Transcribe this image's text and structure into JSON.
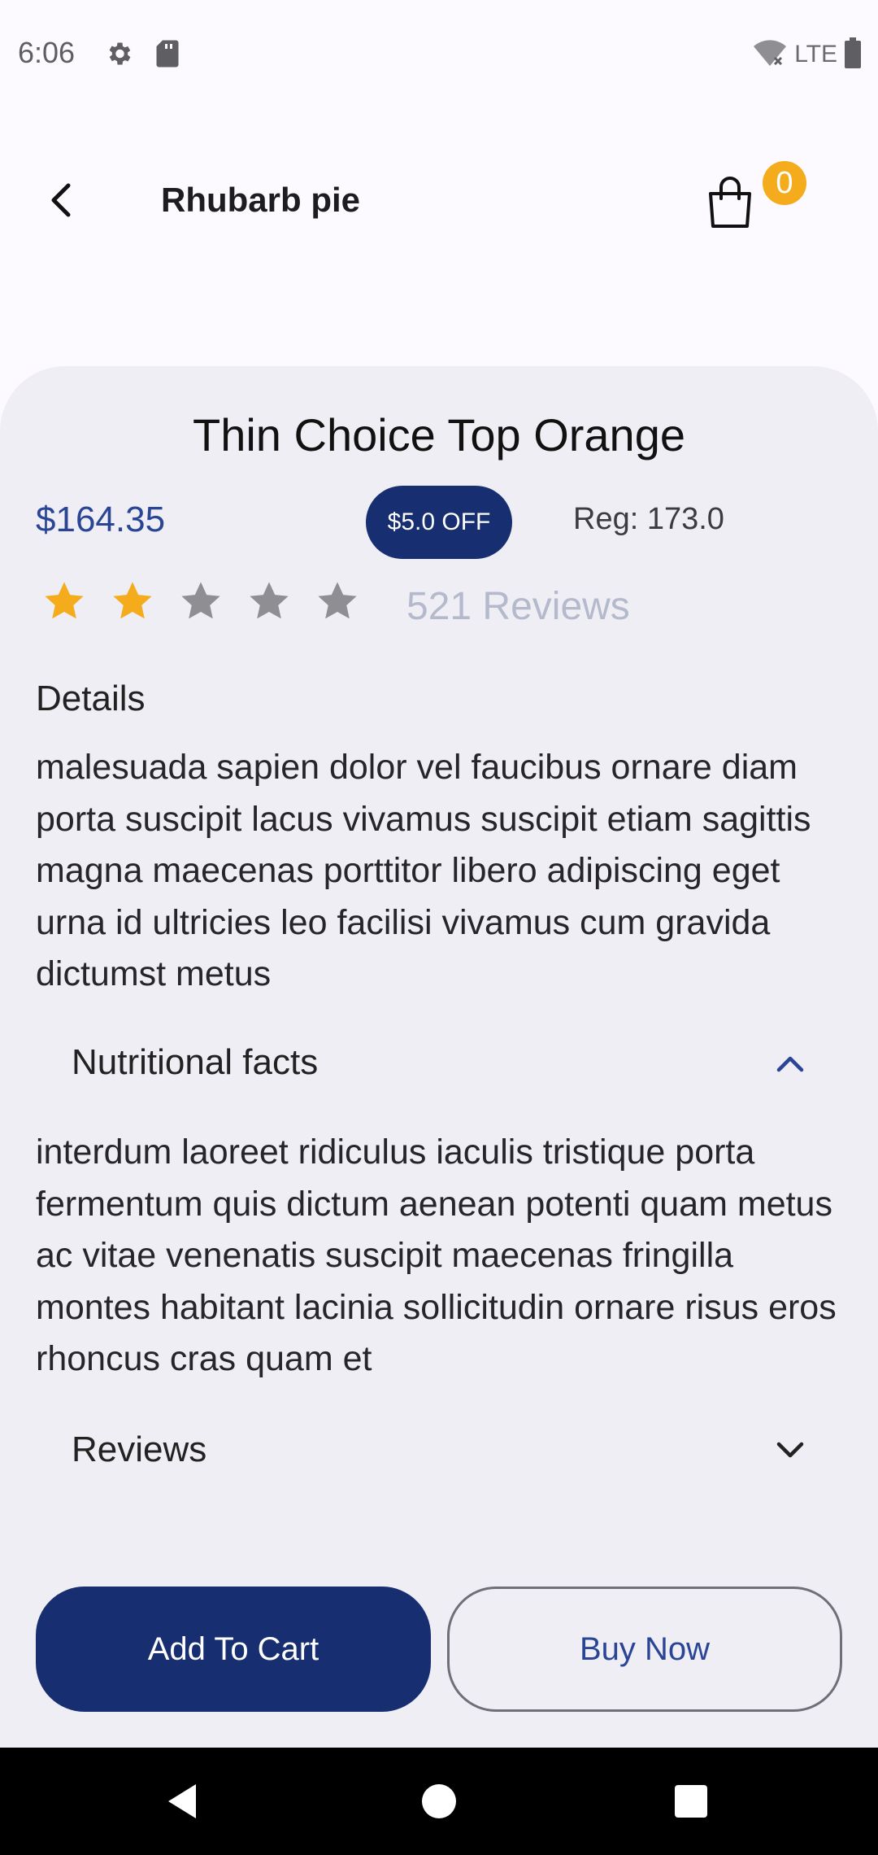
{
  "status_bar": {
    "time": "6:06",
    "network": "LTE",
    "icons": [
      "gear-icon",
      "sd-card-icon",
      "wifi-off-icon",
      "battery-icon"
    ]
  },
  "header": {
    "title": "Rhubarb pie",
    "cart_count": "0",
    "badge_color": "#F5AC1C"
  },
  "product": {
    "name": "Thin Choice Top Orange",
    "price": "$164.35",
    "discount": "$5.0 OFF",
    "regular_price": "Reg: 173.0",
    "rating": 2,
    "rating_max": 5,
    "reviews_label": "521 Reviews"
  },
  "details": {
    "heading": "Details",
    "text": "malesuada sapien dolor vel faucibus ornare diam porta suscipit lacus vivamus suscipit etiam sagittis magna maecenas porttitor libero adipiscing eget urna id ultricies leo facilisi vivamus cum gravida dictumst metus"
  },
  "nutrition": {
    "heading": "Nutritional facts",
    "expanded": true,
    "text": "interdum laoreet ridiculus iaculis tristique porta fermentum quis dictum aenean potenti quam metus ac vitae venenatis suscipit maecenas fringilla montes habitant lacinia sollicitudin ornare risus eros rhoncus cras quam et"
  },
  "reviews_section": {
    "heading": "Reviews",
    "expanded": false
  },
  "actions": {
    "add_to_cart": "Add To Cart",
    "buy_now": "Buy Now"
  },
  "colors": {
    "primary": "#172E70",
    "accent_text": "#2A4595",
    "star_filled": "#F5AC1C",
    "star_empty": "#8E8E93"
  }
}
